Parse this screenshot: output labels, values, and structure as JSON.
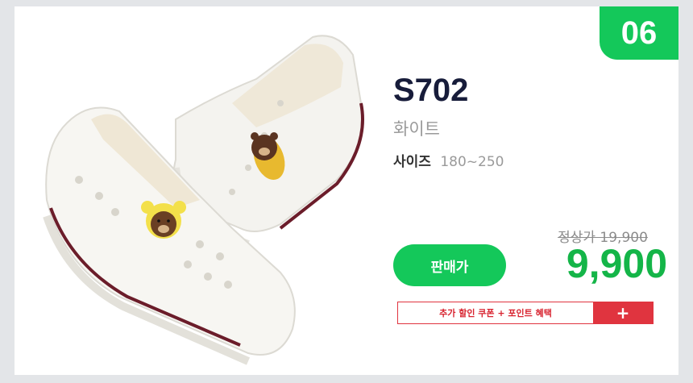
{
  "badge": {
    "number": "06"
  },
  "product": {
    "model": "S702",
    "color": "화이트",
    "size_label": "사이즈",
    "size_value": "180~250"
  },
  "pricing": {
    "sale_button": "판매가",
    "regular_price": "정상가 19,900",
    "sale_price": "9,900"
  },
  "coupon": {
    "text": "추가 할인 쿠폰 + 포인트 혜택",
    "plus": "+"
  },
  "colors": {
    "accent_green": "#14c85a",
    "coupon_red": "#e0343f"
  },
  "image": {
    "subject": "white kids slip-on shoes with bear charms"
  }
}
